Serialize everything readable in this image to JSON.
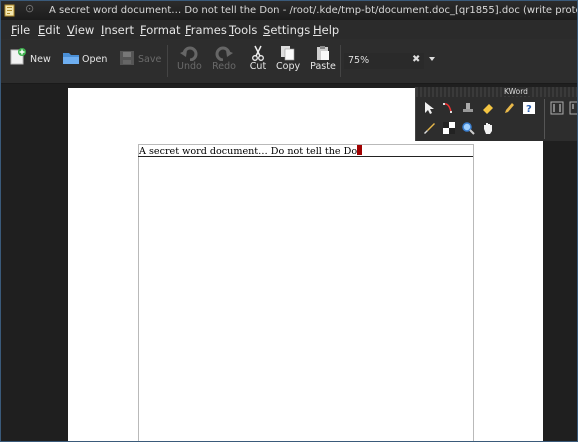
{
  "window": {
    "title": "A secret word document… Do not tell the Don - /root/.kde/tmp-bt/document.doc_[qr1855].doc (write protected) - KWord"
  },
  "menu": [
    "File",
    "Edit",
    "View",
    "Insert",
    "Format",
    "Frames",
    "Tools",
    "Settings",
    "Help"
  ],
  "toolbar": {
    "new": "New",
    "open": "Open",
    "save": "Save",
    "undo": "Undo",
    "redo": "Redo",
    "cut": "Cut",
    "copy": "Copy",
    "paste": "Paste",
    "zoom": "75%"
  },
  "palette": {
    "title": "KWord"
  },
  "document": {
    "text": "A secret word document… Do not tell the Do"
  },
  "colors": {
    "cursor": "#a10000",
    "accent_new": "#3fb34f",
    "open_blue": "#4a8fd6"
  }
}
